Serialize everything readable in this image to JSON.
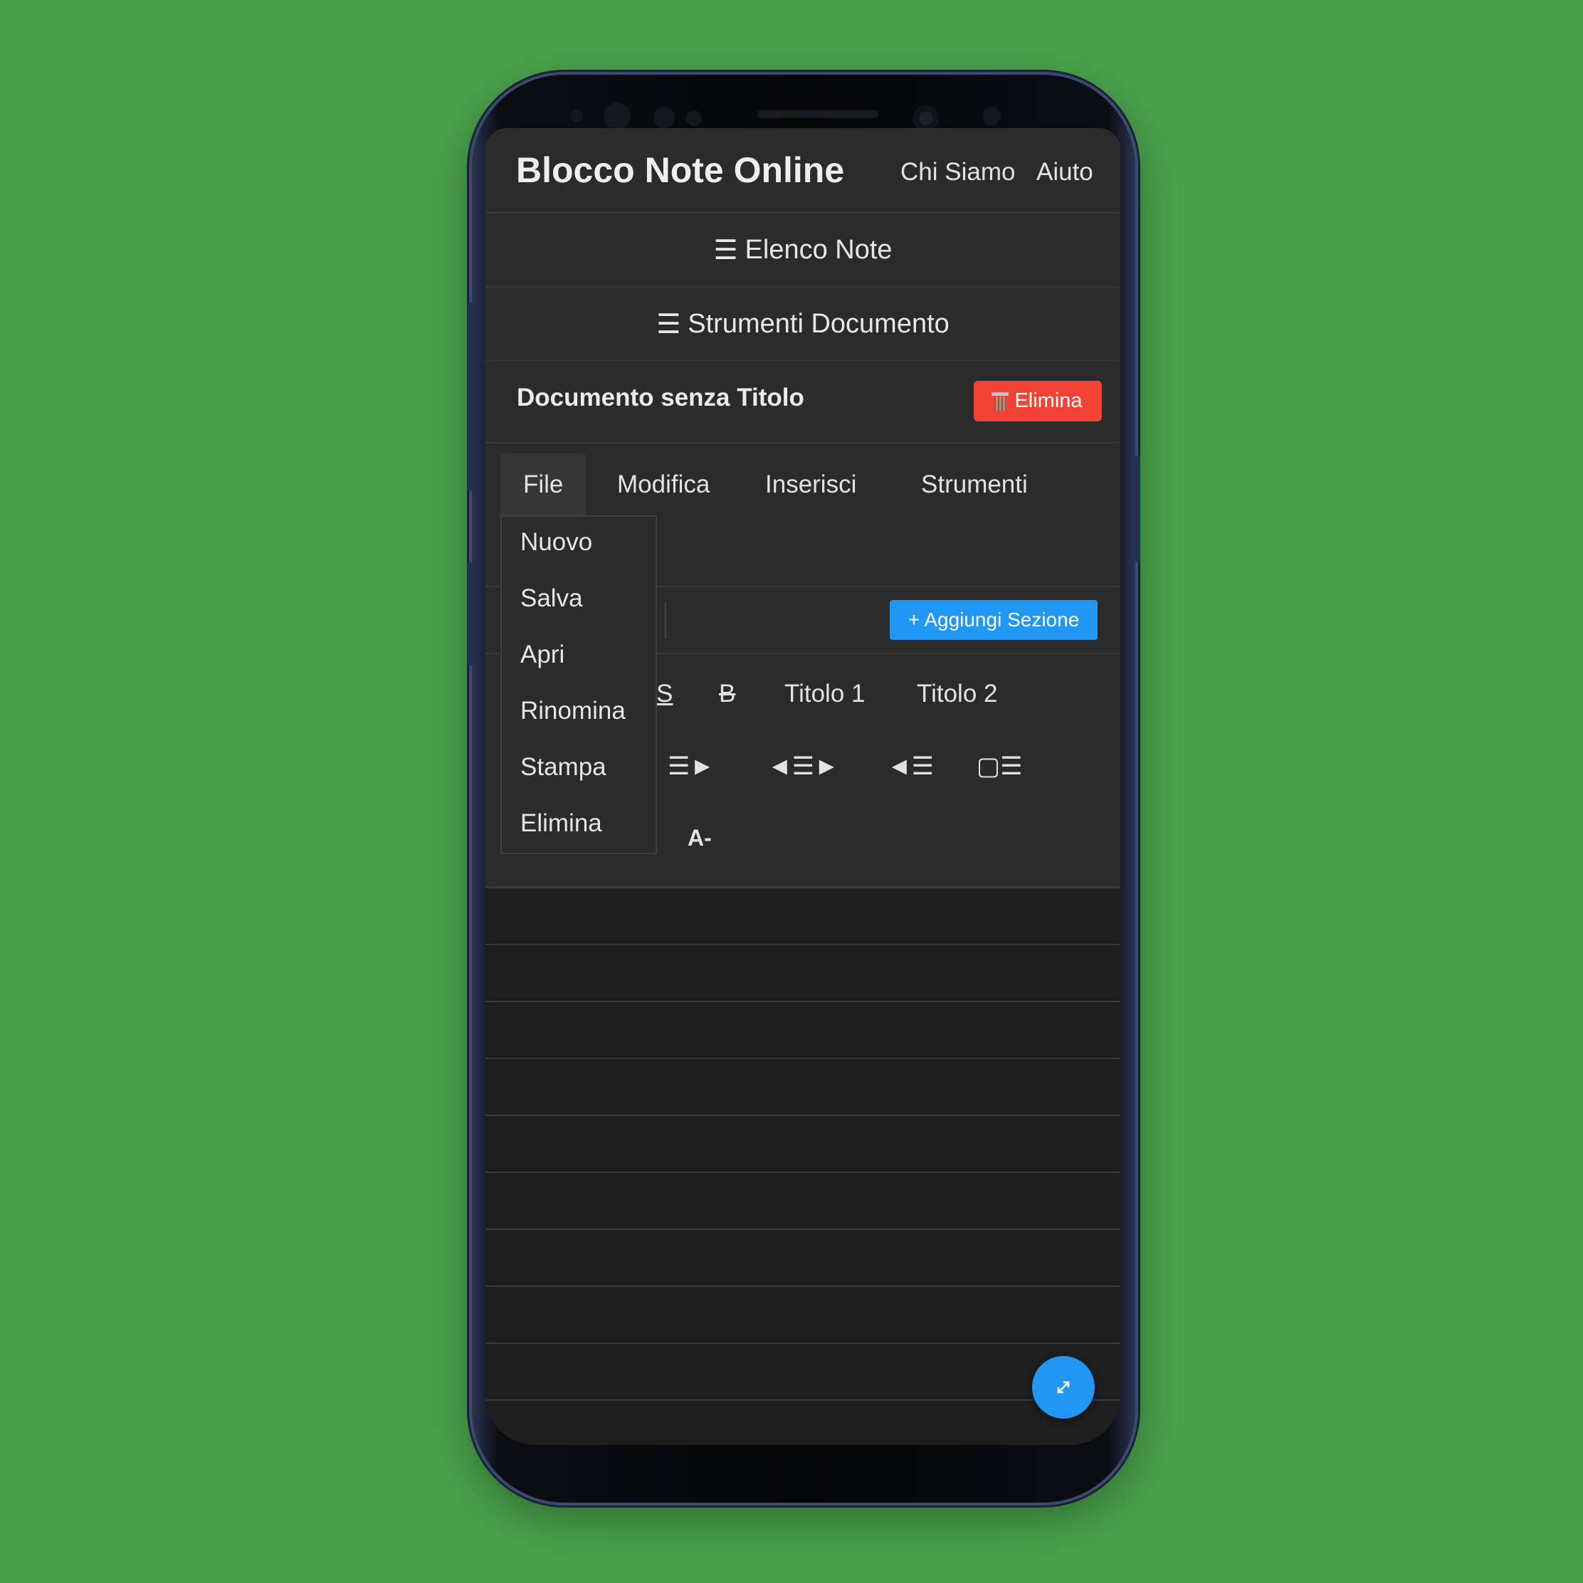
{
  "header": {
    "brand": "Blocco Note Online",
    "nav": [
      "Chi Siamo",
      "Aiuto"
    ]
  },
  "panels": {
    "notes_list": "Elenco Note",
    "doc_tools": "Strumenti Documento"
  },
  "document": {
    "title": "Documento senza Titolo",
    "delete_label": "Elimina"
  },
  "menubar": {
    "items": [
      "File",
      "Modifica",
      "Inserisci",
      "Strumenti"
    ],
    "active": "File"
  },
  "file_menu": {
    "items": [
      "Nuovo",
      "Salva",
      "Apri",
      "Rinomina",
      "Stampa",
      "Elimina"
    ]
  },
  "sections": {
    "add_label": "+ Aggiungi Sezione"
  },
  "toolbar": {
    "row1": [
      "S",
      "B",
      "Titolo 1",
      "Titolo 2"
    ],
    "row2": [
      "☰►",
      "◄☰►",
      "◄☰",
      "▢☰"
    ],
    "row3": [
      "A-"
    ]
  },
  "icons": {
    "panel_toggle": "hamburger-icon",
    "delete": "trash-icon",
    "fab": "expand-arrows-icon"
  },
  "colors": {
    "background": "#49a04b",
    "danger": "#f44336",
    "accent": "#2196f3",
    "panel": "#2b2b2b",
    "editor": "#1e1e1e"
  }
}
